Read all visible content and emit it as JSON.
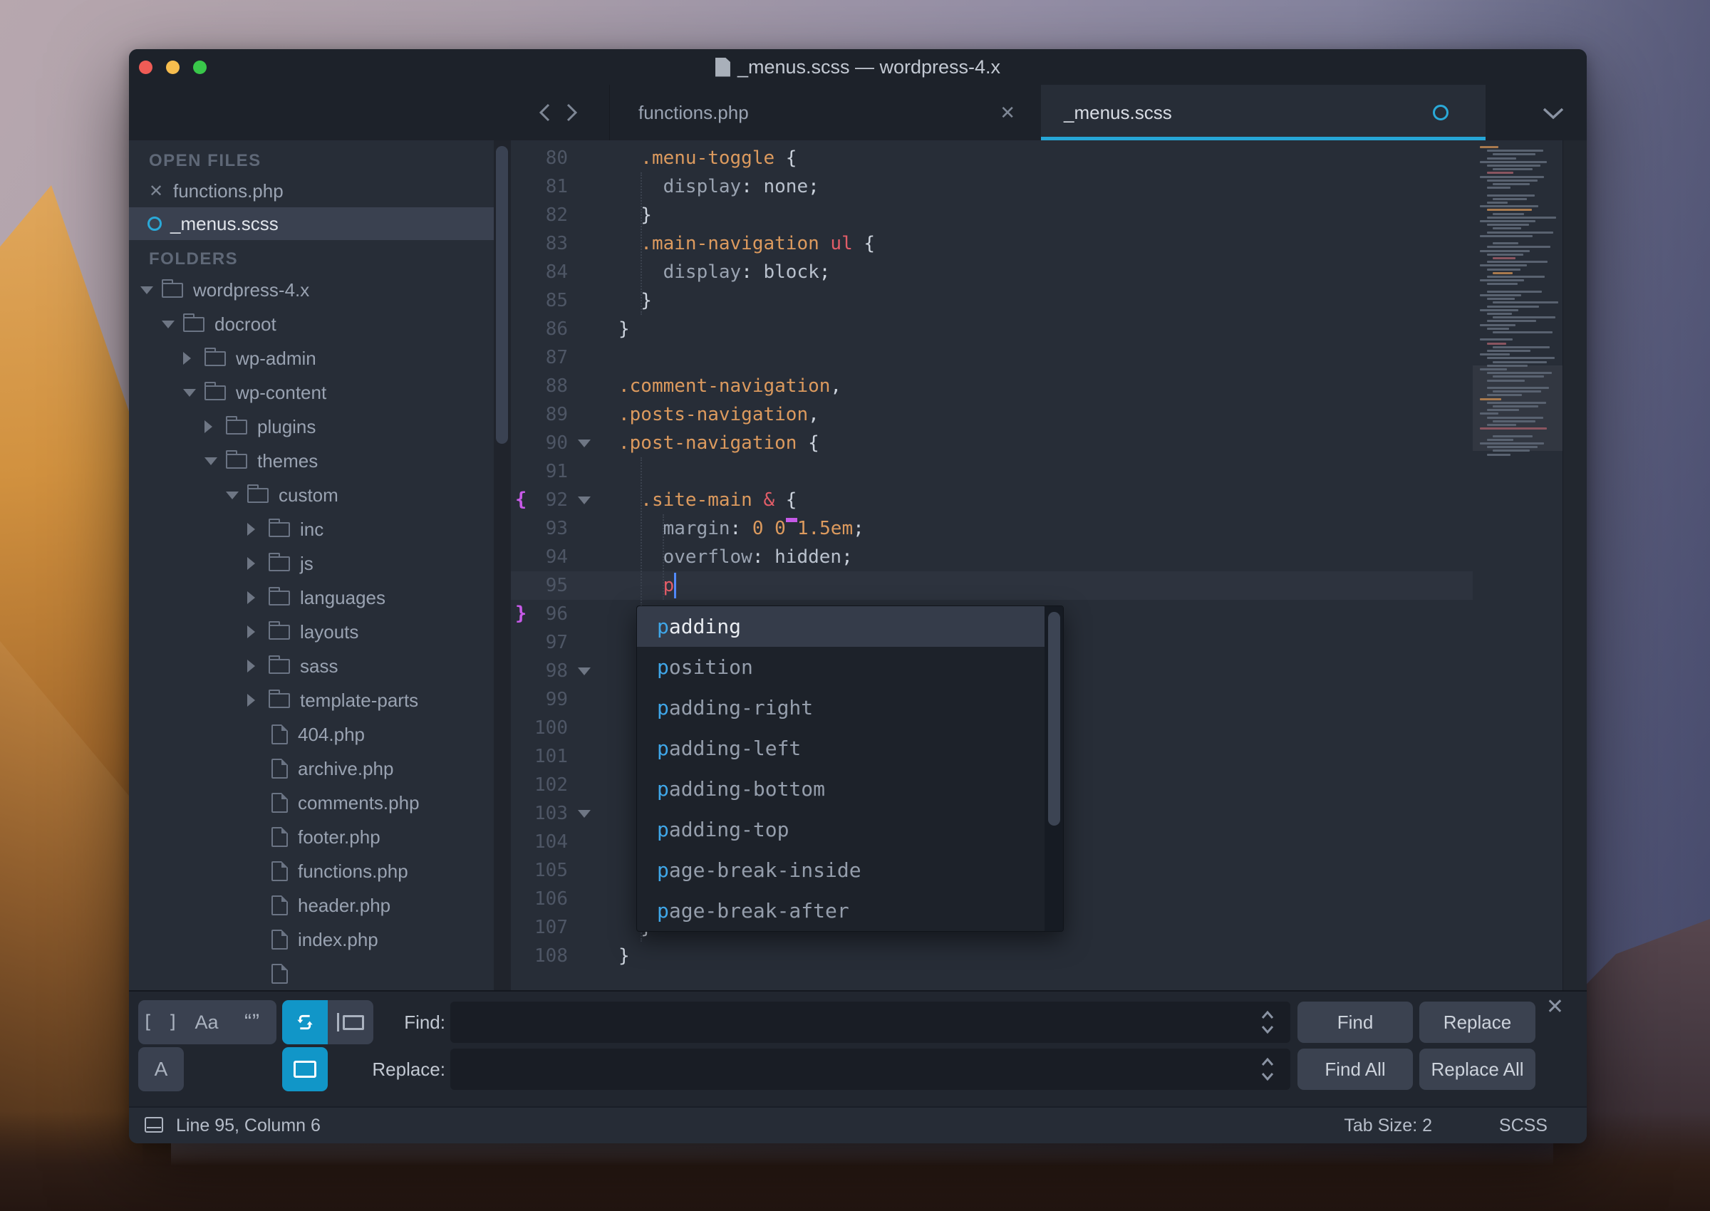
{
  "window": {
    "title": "_menus.scss — wordpress-4.x"
  },
  "tabs": {
    "items": [
      {
        "label": "functions.php",
        "active": false,
        "modified": false
      },
      {
        "label": "_menus.scss",
        "active": true,
        "modified": true
      }
    ]
  },
  "sidebar": {
    "open_files_header": "OPEN FILES",
    "open_files": [
      {
        "label": "functions.php",
        "selected": false,
        "modified": false
      },
      {
        "label": "_menus.scss",
        "selected": true,
        "modified": true
      }
    ],
    "folders_header": "FOLDERS",
    "tree": [
      {
        "label": "wordpress-4.x",
        "depth": 0,
        "kind": "folder",
        "state": "open"
      },
      {
        "label": "docroot",
        "depth": 1,
        "kind": "folder",
        "state": "open"
      },
      {
        "label": "wp-admin",
        "depth": 2,
        "kind": "folder",
        "state": "closed"
      },
      {
        "label": "wp-content",
        "depth": 2,
        "kind": "folder",
        "state": "open"
      },
      {
        "label": "plugins",
        "depth": 3,
        "kind": "folder",
        "state": "closed"
      },
      {
        "label": "themes",
        "depth": 3,
        "kind": "folder",
        "state": "open"
      },
      {
        "label": "custom",
        "depth": 4,
        "kind": "folder",
        "state": "open"
      },
      {
        "label": "inc",
        "depth": 5,
        "kind": "folder",
        "state": "closed"
      },
      {
        "label": "js",
        "depth": 5,
        "kind": "folder",
        "state": "closed"
      },
      {
        "label": "languages",
        "depth": 5,
        "kind": "folder",
        "state": "closed"
      },
      {
        "label": "layouts",
        "depth": 5,
        "kind": "folder",
        "state": "closed"
      },
      {
        "label": "sass",
        "depth": 5,
        "kind": "folder",
        "state": "closed"
      },
      {
        "label": "template-parts",
        "depth": 5,
        "kind": "folder",
        "state": "closed"
      },
      {
        "label": "404.php",
        "depth": 5,
        "kind": "file"
      },
      {
        "label": "archive.php",
        "depth": 5,
        "kind": "file"
      },
      {
        "label": "comments.php",
        "depth": 5,
        "kind": "file"
      },
      {
        "label": "footer.php",
        "depth": 5,
        "kind": "file"
      },
      {
        "label": "functions.php",
        "depth": 5,
        "kind": "file"
      },
      {
        "label": "header.php",
        "depth": 5,
        "kind": "file"
      },
      {
        "label": "index.php",
        "depth": 5,
        "kind": "file"
      },
      {
        "label": "",
        "depth": 5,
        "kind": "file"
      }
    ]
  },
  "editor": {
    "cursor": {
      "line": 95,
      "column": 6
    },
    "lines": [
      {
        "n": 80,
        "tk": [
          [
            "sel",
            "  .menu-toggle"
          ],
          [
            "punc",
            " {"
          ]
        ]
      },
      {
        "n": 81,
        "tk": [
          [
            "prop",
            "    display"
          ],
          [
            "punc",
            ":"
          ],
          [
            "val",
            " none"
          ],
          [
            "punc",
            ";"
          ]
        ]
      },
      {
        "n": 82,
        "tk": [
          [
            "punc",
            "  }"
          ]
        ]
      },
      {
        "n": 83,
        "tk": [
          [
            "sel",
            "  .main-navigation"
          ],
          [
            "red",
            " ul"
          ],
          [
            "punc",
            " {"
          ]
        ]
      },
      {
        "n": 84,
        "tk": [
          [
            "prop",
            "    display"
          ],
          [
            "punc",
            ":"
          ],
          [
            "val",
            " block"
          ],
          [
            "punc",
            ";"
          ]
        ]
      },
      {
        "n": 85,
        "tk": [
          [
            "punc",
            "  }"
          ]
        ]
      },
      {
        "n": 86,
        "tk": [
          [
            "punc",
            "}"
          ]
        ]
      },
      {
        "n": 87,
        "tk": []
      },
      {
        "n": 88,
        "tk": [
          [
            "sel",
            ".comment-navigation"
          ],
          [
            "punc",
            ","
          ]
        ]
      },
      {
        "n": 89,
        "tk": [
          [
            "sel",
            ".posts-navigation"
          ],
          [
            "punc",
            ","
          ]
        ]
      },
      {
        "n": 90,
        "fold": true,
        "tk": [
          [
            "sel",
            ".post-navigation"
          ],
          [
            "punc",
            " {"
          ]
        ]
      },
      {
        "n": 91,
        "tk": []
      },
      {
        "n": 92,
        "fold": true,
        "gb": "{",
        "tk": [
          [
            "sel",
            "  .site-main"
          ],
          [
            "red",
            " &"
          ],
          [
            "punc",
            " {"
          ]
        ]
      },
      {
        "n": 93,
        "tk": [
          [
            "prop",
            "    margin"
          ],
          [
            "punc",
            ":"
          ],
          [
            "num",
            " 0 0"
          ],
          [
            "omark",
            " "
          ],
          [
            "num",
            "1.5em"
          ],
          [
            "punc",
            ";"
          ]
        ]
      },
      {
        "n": 94,
        "tk": [
          [
            "prop",
            "    overflow"
          ],
          [
            "punc",
            ":"
          ],
          [
            "val",
            " hidden"
          ],
          [
            "punc",
            ";"
          ]
        ]
      },
      {
        "n": 95,
        "cur": true,
        "tk": [
          [
            "red",
            "    p"
          ]
        ]
      },
      {
        "n": 96,
        "gb": "}",
        "tk": [
          [
            "punc",
            "  "
          ],
          [
            "puncu",
            "}"
          ]
        ]
      },
      {
        "n": 97,
        "tk": []
      },
      {
        "n": 98,
        "fold": true,
        "tk": [
          [
            "sel",
            "  ."
          ]
        ]
      },
      {
        "n": 99,
        "tk": []
      },
      {
        "n": 100,
        "tk": []
      },
      {
        "n": 101,
        "tk": [
          [
            "punc",
            "  }"
          ]
        ]
      },
      {
        "n": 102,
        "tk": []
      },
      {
        "n": 103,
        "fold": true,
        "tk": [
          [
            "sel",
            "  ."
          ]
        ]
      },
      {
        "n": 104,
        "tk": []
      },
      {
        "n": 105,
        "tk": []
      },
      {
        "n": 106,
        "tk": []
      },
      {
        "n": 107,
        "tk": [
          [
            "punc",
            "  }"
          ]
        ]
      },
      {
        "n": 108,
        "tk": [
          [
            "punc",
            "}"
          ]
        ]
      }
    ],
    "popup": {
      "items": [
        {
          "match": "p",
          "rest": "adding",
          "selected": true
        },
        {
          "match": "p",
          "rest": "osition",
          "selected": false
        },
        {
          "match": "p",
          "rest": "adding-right",
          "selected": false
        },
        {
          "match": "p",
          "rest": "adding-left",
          "selected": false
        },
        {
          "match": "p",
          "rest": "adding-bottom",
          "selected": false
        },
        {
          "match": "p",
          "rest": "adding-top",
          "selected": false
        },
        {
          "match": "p",
          "rest": "age-break-inside",
          "selected": false
        },
        {
          "match": "p",
          "rest": "age-break-after",
          "selected": false
        }
      ]
    }
  },
  "find_panel": {
    "find_label": "Find:",
    "replace_label": "Replace:",
    "find_value": "",
    "replace_value": "",
    "toggles": {
      "regex": "[ ]",
      "match_case": "Aa",
      "whole_word": "“”",
      "preserve_case": "A"
    },
    "buttons": {
      "find": "Find",
      "replace": "Replace",
      "find_all": "Find All",
      "replace_all": "Replace All"
    }
  },
  "status_bar": {
    "position": "Line 95, Column 6",
    "tab_size": "Tab Size: 2",
    "grammar": "SCSS"
  },
  "colors": {
    "accent_cyan": "#26a6d6",
    "toggle_cyan": "#1196c8",
    "orange": "#dc9a5e",
    "red": "#e25d68",
    "purple": "#c75ae8",
    "cursor_blue": "#528bff",
    "editor_bg": "#272d37",
    "chrome_bg": "#1d222a"
  }
}
